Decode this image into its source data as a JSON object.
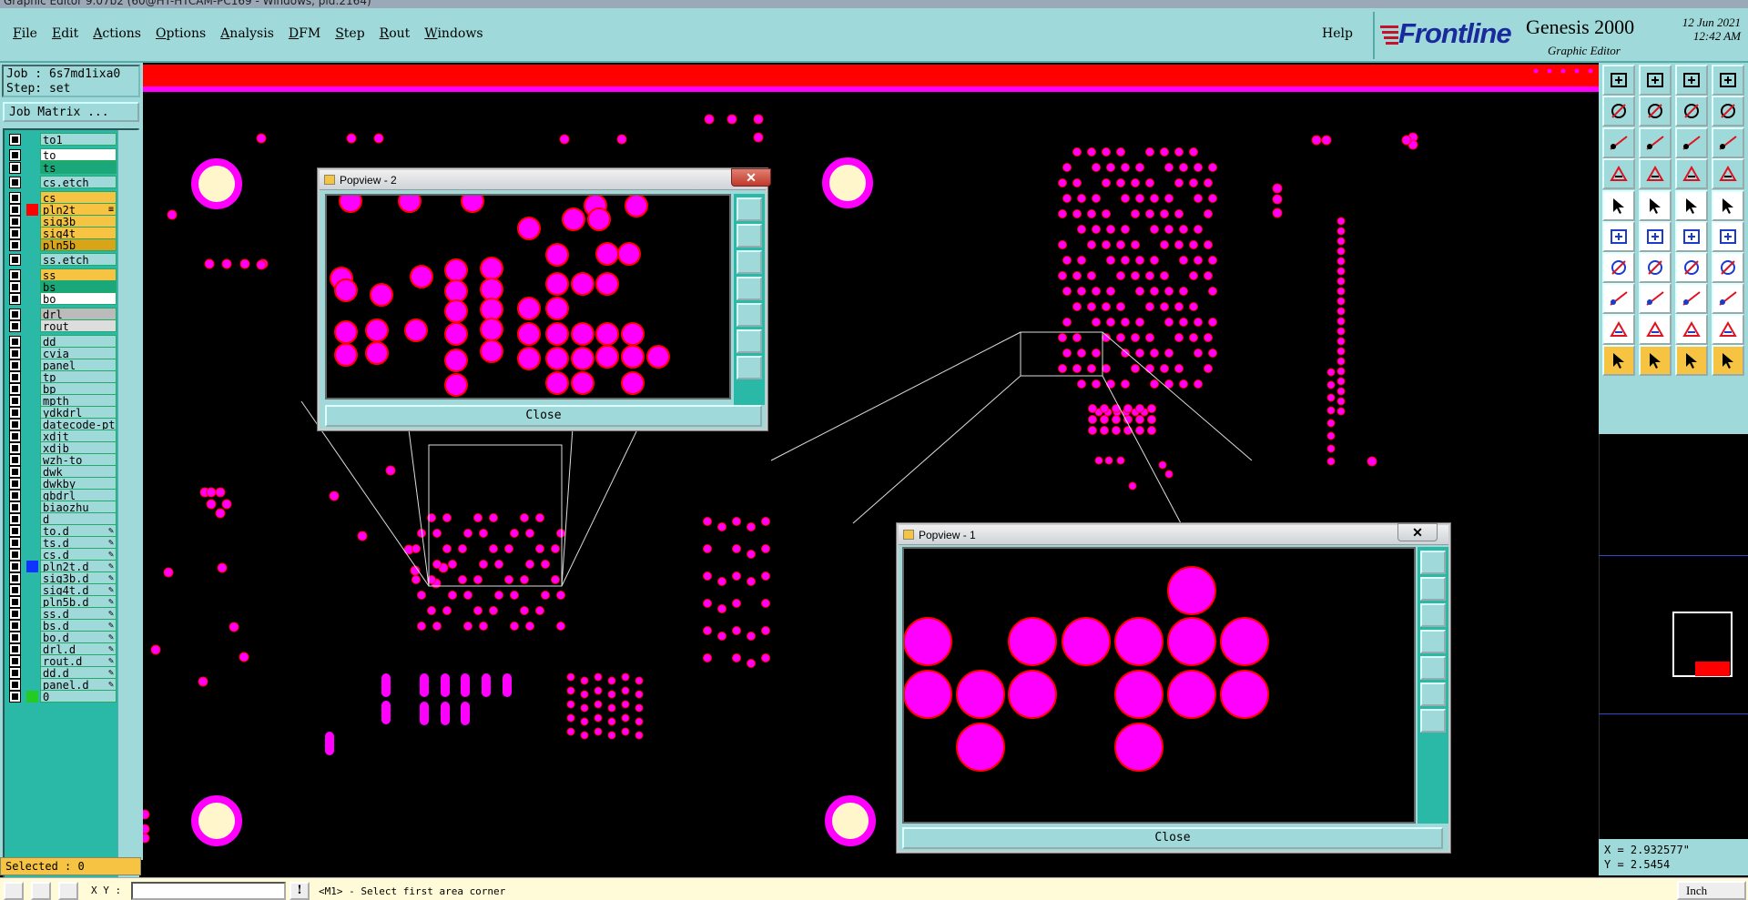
{
  "title_bar": {
    "text": "Graphic Editor 9.07b2 (60@HT-HTCAM-PC169 - Windows, pid:2164)"
  },
  "menu": {
    "items": [
      "File",
      "Edit",
      "Actions",
      "Options",
      "Analysis",
      "DFM",
      "Step",
      "Rout",
      "Windows"
    ],
    "help": "Help"
  },
  "brand": {
    "logo": "Frontline",
    "product": "Genesis 2000",
    "subtitle": "Graphic Editor",
    "date": "12 Jun 2021",
    "time": "12:42 AM"
  },
  "job": {
    "job_line": "Job : 6s7md1ixa0",
    "step_line": "Step: set",
    "matrix_button": "Job Matrix ..."
  },
  "layers": [
    {
      "name": "to1",
      "color": "#9fd9d9"
    },
    {
      "name": "to",
      "color": "#ffffff"
    },
    {
      "name": "ts",
      "color": "#1aa77a"
    },
    {
      "name": "cs.etch",
      "color": "#9fd9d9"
    },
    {
      "name": "cs",
      "color": "#f6c343"
    },
    {
      "name": "pln2t",
      "color": "#f6c343",
      "swatch": "#ff0000",
      "mark": "≡"
    },
    {
      "name": "sig3b",
      "color": "#f6c343"
    },
    {
      "name": "sig4t",
      "color": "#f6c343"
    },
    {
      "name": "pln5b",
      "color": "#d9a418"
    },
    {
      "name": "ss.etch",
      "color": "#9fd9d9"
    },
    {
      "name": "ss",
      "color": "#f6c343"
    },
    {
      "name": "bs",
      "color": "#1aa77a"
    },
    {
      "name": "bo",
      "color": "#ffffff"
    },
    {
      "name": "drl",
      "color": "#bbbbbb"
    },
    {
      "name": "rout",
      "color": "#dddddd"
    },
    {
      "name": "dd",
      "color": "#9fd9d9"
    },
    {
      "name": "cvia",
      "color": "#9fd9d9"
    },
    {
      "name": "panel",
      "color": "#9fd9d9"
    },
    {
      "name": "tp",
      "color": "#9fd9d9"
    },
    {
      "name": "bp",
      "color": "#9fd9d9"
    },
    {
      "name": "mpth",
      "color": "#9fd9d9"
    },
    {
      "name": "ydkdrl",
      "color": "#9fd9d9"
    },
    {
      "name": "datecode-pth",
      "color": "#9fd9d9"
    },
    {
      "name": "xdjt",
      "color": "#9fd9d9"
    },
    {
      "name": "xdjb",
      "color": "#9fd9d9"
    },
    {
      "name": "wzh-to",
      "color": "#9fd9d9"
    },
    {
      "name": "dwk",
      "color": "#9fd9d9"
    },
    {
      "name": "dwkby",
      "color": "#9fd9d9"
    },
    {
      "name": "gbdrl",
      "color": "#9fd9d9"
    },
    {
      "name": "biaozhu",
      "color": "#9fd9d9"
    },
    {
      "name": "d",
      "color": "#9fd9d9"
    },
    {
      "name": "to.d",
      "color": "#9fd9d9",
      "mark": "✎"
    },
    {
      "name": "ts.d",
      "color": "#9fd9d9",
      "mark": "✎"
    },
    {
      "name": "cs.d",
      "color": "#9fd9d9",
      "mark": "✎"
    },
    {
      "name": "pln2t.d",
      "color": "#9fd9d9",
      "swatch": "#1034ff",
      "mark": "✎"
    },
    {
      "name": "sig3b.d",
      "color": "#9fd9d9",
      "mark": "✎"
    },
    {
      "name": "sig4t.d",
      "color": "#9fd9d9",
      "mark": "✎"
    },
    {
      "name": "pln5b.d",
      "color": "#9fd9d9",
      "mark": "✎"
    },
    {
      "name": "ss.d",
      "color": "#9fd9d9",
      "mark": "✎"
    },
    {
      "name": "bs.d",
      "color": "#9fd9d9",
      "mark": "✎"
    },
    {
      "name": "bo.d",
      "color": "#9fd9d9",
      "mark": "✎"
    },
    {
      "name": "drl.d",
      "color": "#9fd9d9",
      "mark": "✎"
    },
    {
      "name": "rout.d",
      "color": "#9fd9d9",
      "mark": "✎"
    },
    {
      "name": "dd.d",
      "color": "#9fd9d9",
      "mark": "✎"
    },
    {
      "name": "panel.d",
      "color": "#9fd9d9",
      "mark": "✎"
    },
    {
      "name": "0",
      "color": "#9fd9d9",
      "swatch": "#22cc22"
    }
  ],
  "selected": "Selected : 0",
  "popview2": {
    "title": "Popview - 2",
    "close_label": "Close",
    "x_label": "✕"
  },
  "popview1": {
    "title": "Popview - 1",
    "close_label": "Close",
    "x_label": "✕"
  },
  "coords": {
    "x": "X = 2.932577\"",
    "y": "Y = 2.5454"
  },
  "status": {
    "xy_label": "X Y :",
    "xy_value": "",
    "excl": "!",
    "prompt": "<M1> - Select first area corner",
    "unit": "Inch"
  },
  "colors": {
    "pad": "#ff00ff",
    "pad_outline": "#ff0000",
    "panel": "#9fd9d9",
    "layer_area": "#2ab9a6"
  }
}
